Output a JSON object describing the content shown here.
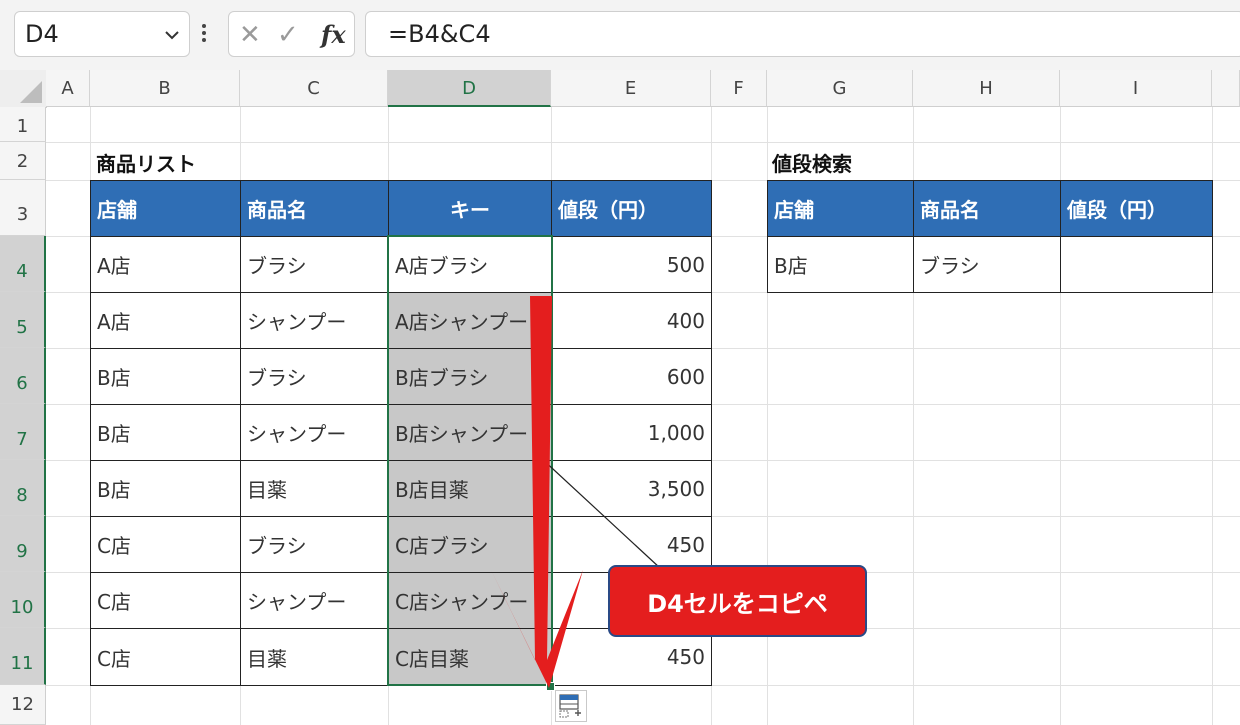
{
  "formula_bar": {
    "name_box": "D4",
    "formula": "=B4&C4",
    "cancel_glyph": "✕",
    "enter_glyph": "✓",
    "fx_label": "fx"
  },
  "columns": [
    "A",
    "B",
    "C",
    "D",
    "E",
    "F",
    "G",
    "H",
    "I"
  ],
  "rows": [
    "1",
    "2",
    "3",
    "4",
    "5",
    "6",
    "7",
    "8",
    "9",
    "10",
    "11",
    "12"
  ],
  "left_table": {
    "title": "商品リスト",
    "headers": [
      "店舗",
      "商品名",
      "キー",
      "値段（円）"
    ],
    "rows": [
      [
        "A店",
        "ブラシ",
        "A店ブラシ",
        "500"
      ],
      [
        "A店",
        "シャンプー",
        "A店シャンプー",
        "400"
      ],
      [
        "B店",
        "ブラシ",
        "B店ブラシ",
        "600"
      ],
      [
        "B店",
        "シャンプー",
        "B店シャンプー",
        "1,000"
      ],
      [
        "B店",
        "目薬",
        "B店目薬",
        "3,500"
      ],
      [
        "C店",
        "ブラシ",
        "C店ブラシ",
        "450"
      ],
      [
        "C店",
        "シャンプー",
        "C店シャンプー",
        ""
      ],
      [
        "C店",
        "目薬",
        "C店目薬",
        "450"
      ]
    ]
  },
  "right_table": {
    "title": "値段検索",
    "headers": [
      "店舗",
      "商品名",
      "値段（円）"
    ],
    "row": [
      "B店",
      "ブラシ",
      ""
    ]
  },
  "annotation": {
    "callout_text": "D4セルをコピペ"
  },
  "colors": {
    "header_blue": "#2f6eb5",
    "selection_green": "#217346",
    "arrow_red": "#e41e1e",
    "fill_gray": "#c8c8c8"
  },
  "icons": [
    "chevron-down-icon",
    "more-vertical-icon",
    "cancel-icon",
    "enter-icon",
    "function-icon",
    "select-all-icon",
    "paste-options-icon"
  ]
}
